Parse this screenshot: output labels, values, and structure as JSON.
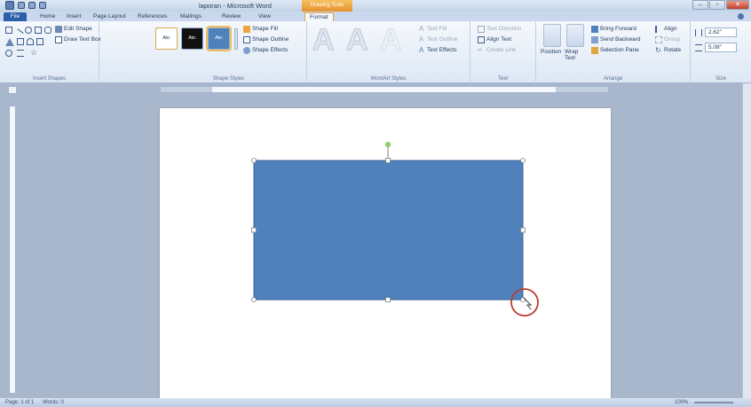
{
  "window": {
    "title": "laporan - Microsoft Word",
    "context_tab": "Drawing Tools"
  },
  "tabs": [
    "File",
    "Home",
    "Insert",
    "Page Layout",
    "References",
    "Mailings",
    "Review",
    "View",
    "Format"
  ],
  "active_tab": "Format",
  "ribbon": {
    "insert_shapes": {
      "edit_shape": "Edit Shape",
      "draw_text_box": "Draw Text Box",
      "label": "Insert Shapes"
    },
    "shape_styles": {
      "swatch_1": "Abc",
      "swatch_2": "Abc",
      "swatch_3": "Abc",
      "fill": "Shape Fill",
      "outline": "Shape Outline",
      "effects": "Shape Effects",
      "label": "Shape Styles"
    },
    "wordart": {
      "glyph_1": "A",
      "glyph_2": "A",
      "glyph_3": "A",
      "text_fill": "Text Fill",
      "text_outline": "Text Outline",
      "text_effects": "Text Effects",
      "label": "WordArt Styles"
    },
    "text": {
      "direction": "Text Direction",
      "align": "Align Text",
      "link": "Create Link",
      "label": "Text"
    },
    "arrange": {
      "position": "Position",
      "wrap_text": "Wrap Text",
      "bring_forward": "Bring Forward",
      "send_backward": "Send Backward",
      "selection_pane": "Selection Pane",
      "align": "Align",
      "group": "Group",
      "rotate": "Rotate",
      "label": "Arrange"
    },
    "size": {
      "height": "2.62\"",
      "width": "5.08\"",
      "label": "Size"
    }
  },
  "status": {
    "page": "Page: 1 of 1",
    "words": "Words: 0",
    "zoom": "100%"
  },
  "colors": {
    "shape_fill": "#4f81bd",
    "shape_border": "#3b6698",
    "rotation_handle": "#8fd16a",
    "highlight_circle": "#c0392b"
  }
}
